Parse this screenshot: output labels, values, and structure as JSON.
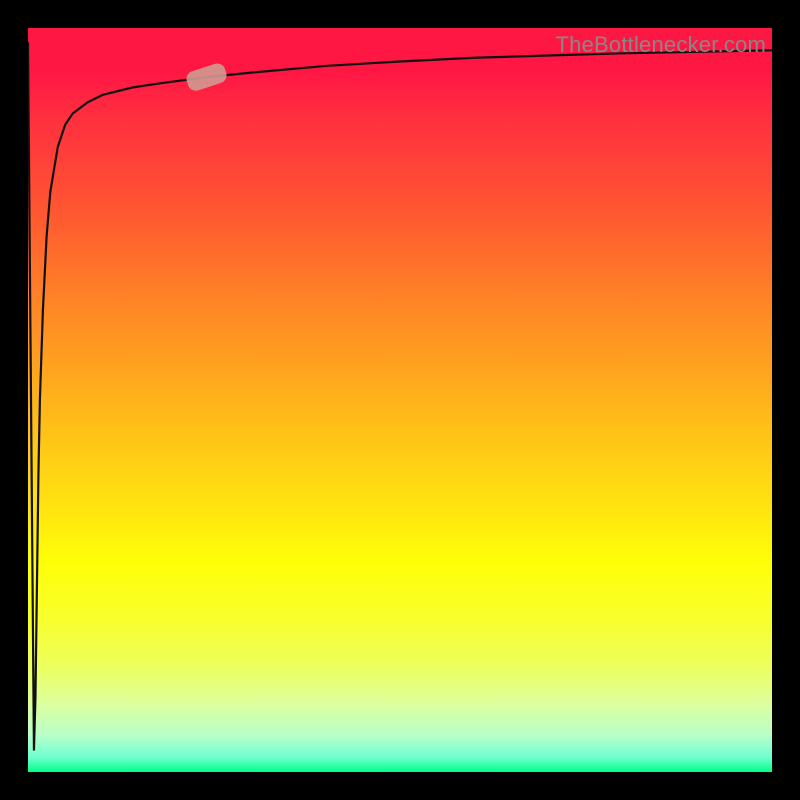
{
  "watermark": "TheBottlenecker.com",
  "colors": {
    "frame": "#000000",
    "gradient_top": "#ff1744",
    "gradient_mid": "#ffff08",
    "gradient_bottom": "#00ff88",
    "curve": "#111111",
    "marker": "#d29a92"
  },
  "chart_data": {
    "type": "line",
    "title": "",
    "xlabel": "",
    "ylabel": "",
    "xlim": [
      0,
      100
    ],
    "ylim": [
      0,
      100
    ],
    "grid": false,
    "legend": false,
    "series": [
      {
        "name": "bottleneck-curve",
        "x": [
          0.0,
          0.8,
          1.0,
          1.2,
          1.4,
          1.6,
          2.0,
          2.5,
          3.0,
          4.0,
          5.0,
          6.0,
          8.0,
          10.0,
          14.0,
          18.0,
          24.0,
          30.0,
          40.0,
          50.0,
          60.0,
          70.0,
          80.0,
          90.0,
          100.0
        ],
        "y": [
          98.0,
          3.0,
          10.0,
          25.0,
          40.0,
          50.0,
          62.0,
          72.0,
          78.0,
          84.0,
          87.0,
          88.5,
          90.0,
          91.0,
          92.0,
          92.6,
          93.4,
          94.0,
          94.9,
          95.5,
          96.0,
          96.3,
          96.6,
          96.8,
          97.0
        ]
      }
    ],
    "marker": {
      "series": "bottleneck-curve",
      "x": 24.0,
      "y": 93.4,
      "shape": "rounded-rect",
      "angle_deg": -18
    }
  }
}
